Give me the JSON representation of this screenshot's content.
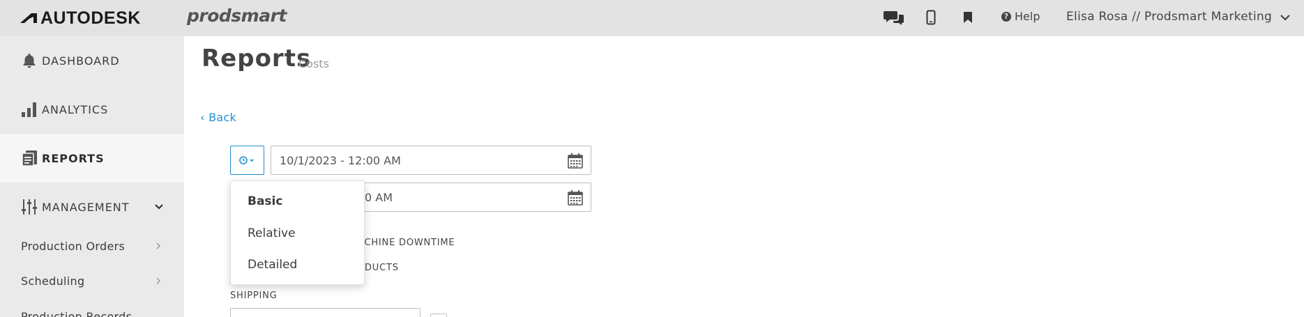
{
  "header": {
    "brand": "AUTODESK",
    "product": "prodsmart",
    "help_label": "Help",
    "user_label": "Elisa Rosa // Prodsmart Marketing"
  },
  "sidebar": {
    "items": [
      {
        "label": "DASHBOARD",
        "icon": "bell-icon"
      },
      {
        "label": "ANALYTICS",
        "icon": "bar-chart-icon"
      },
      {
        "label": "REPORTS",
        "icon": "report-icon",
        "active": true
      },
      {
        "label": "MANAGEMENT",
        "icon": "sliders-icon"
      }
    ],
    "subitems": [
      {
        "label": "Production Orders"
      },
      {
        "label": "Scheduling"
      },
      {
        "label": "Production Records"
      }
    ]
  },
  "main": {
    "title": "Reports",
    "subtitle": "Costs",
    "back_label": "‹ Back",
    "date_from": "10/1/2023 - 12:00 AM",
    "date_to_visible": "0 AM",
    "option_machine_downtime": "ACHINE DOWNTIME",
    "option_products": "DUCTS",
    "shipping_label": "SHIPPING"
  },
  "dropdown": {
    "options": [
      "Basic",
      "Relative",
      "Detailed"
    ],
    "selected": "Basic"
  },
  "colors": {
    "accent": "#1f8fce",
    "topbar_bg": "#e3e3e3",
    "sidebar_bg": "#eaeaea",
    "sidebar_active_bg": "#f6f6f6"
  }
}
